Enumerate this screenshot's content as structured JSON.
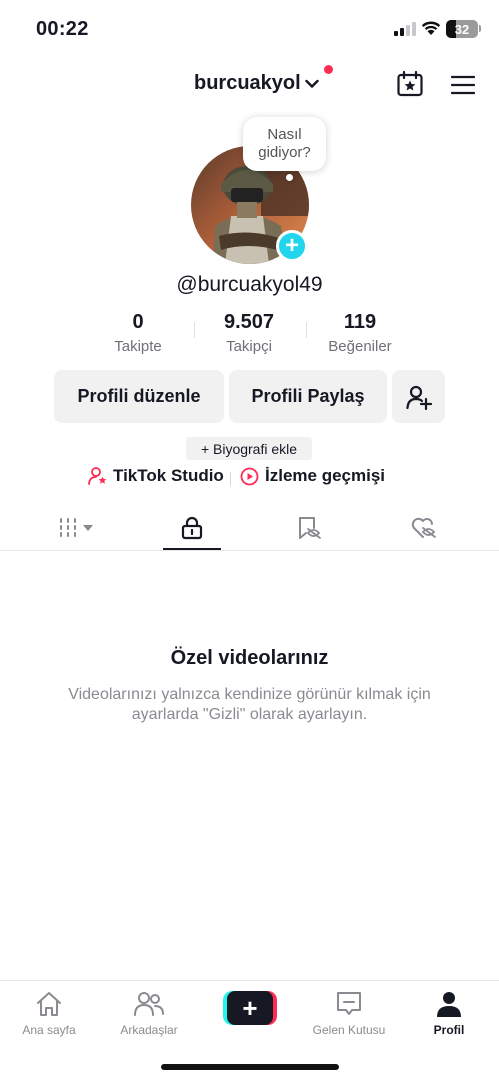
{
  "status_bar": {
    "time": "00:22",
    "battery": "32",
    "battery_level": 0.32
  },
  "header": {
    "username": "burcuakyol"
  },
  "profile": {
    "bubble": "Nasıl gidiyor?",
    "handle": "@burcuakyol49",
    "stats": [
      {
        "value": "0",
        "label": "Takipte"
      },
      {
        "value": "9.507",
        "label": "Takipçi"
      },
      {
        "value": "119",
        "label": "Beğeniler"
      }
    ],
    "edit_button": "Profili düzenle",
    "share_button": "Profili Paylaş",
    "bio_button": "+ Biyografi ekle",
    "studio_link": "TikTok Studio",
    "history_link": "İzleme geçmişi"
  },
  "empty_state": {
    "title": "Özel videolarınız",
    "description": "Videolarınızı yalnızca kendinize görünür kılmak için ayarlarda \"Gizli\" olarak ayarlayın."
  },
  "bottom_nav": [
    {
      "label": "Ana sayfa",
      "icon": "home-icon"
    },
    {
      "label": "Arkadaşlar",
      "icon": "friends-icon"
    },
    {
      "label": "",
      "icon": "create-icon"
    },
    {
      "label": "Gelen Kutusu",
      "icon": "inbox-icon"
    },
    {
      "label": "Profil",
      "icon": "profile-icon"
    }
  ],
  "colors": {
    "accent": "#fe2c55",
    "cyan": "#20d5ec",
    "text": "#161823",
    "muted": "#8a8b91"
  }
}
